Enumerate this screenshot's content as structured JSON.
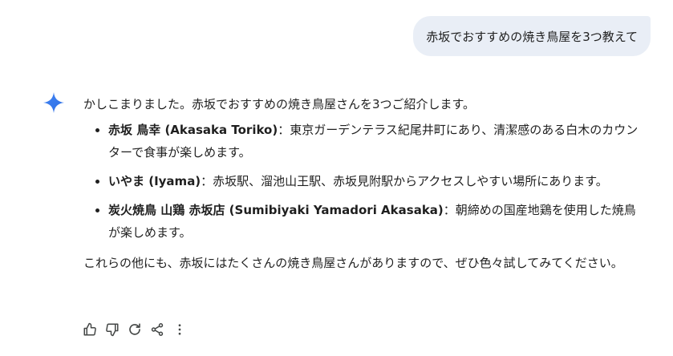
{
  "user_message": "赤坂でおすすめの焼き鳥屋を3つ教えて",
  "response": {
    "intro": "かしこまりました。赤坂でおすすめの焼き鳥屋さんを3つご紹介します。",
    "items": [
      {
        "name": "赤坂 鳥幸 (Akasaka Toriko)",
        "desc": "：東京ガーデンテラス紀尾井町にあり、清潔感のある白木のカウンターで食事が楽しめます。"
      },
      {
        "name": "いやま (Iyama)",
        "desc": "：赤坂駅、溜池山王駅、赤坂見附駅からアクセスしやすい場所にあります。"
      },
      {
        "name": "炭火焼鳥 山鶏 赤坂店 (Sumibiyaki Yamadori Akasaka)",
        "desc": "：朝締めの国産地鶏を使用した焼鳥が楽しめます。"
      }
    ],
    "closing": "これらの他にも、赤坂にはたくさんの焼き鳥屋さんがありますので、ぜひ色々試してみてください。"
  },
  "actions": [
    {
      "icon": "thumbs-up-icon"
    },
    {
      "icon": "thumbs-down-icon"
    },
    {
      "icon": "regenerate-icon"
    },
    {
      "icon": "share-icon"
    },
    {
      "icon": "more-vert-icon"
    }
  ],
  "colors": {
    "user_bubble_bg": "#e9eef6",
    "text": "#1f1f1f",
    "icon": "#444746",
    "gemini_blue": "#4285f4"
  }
}
